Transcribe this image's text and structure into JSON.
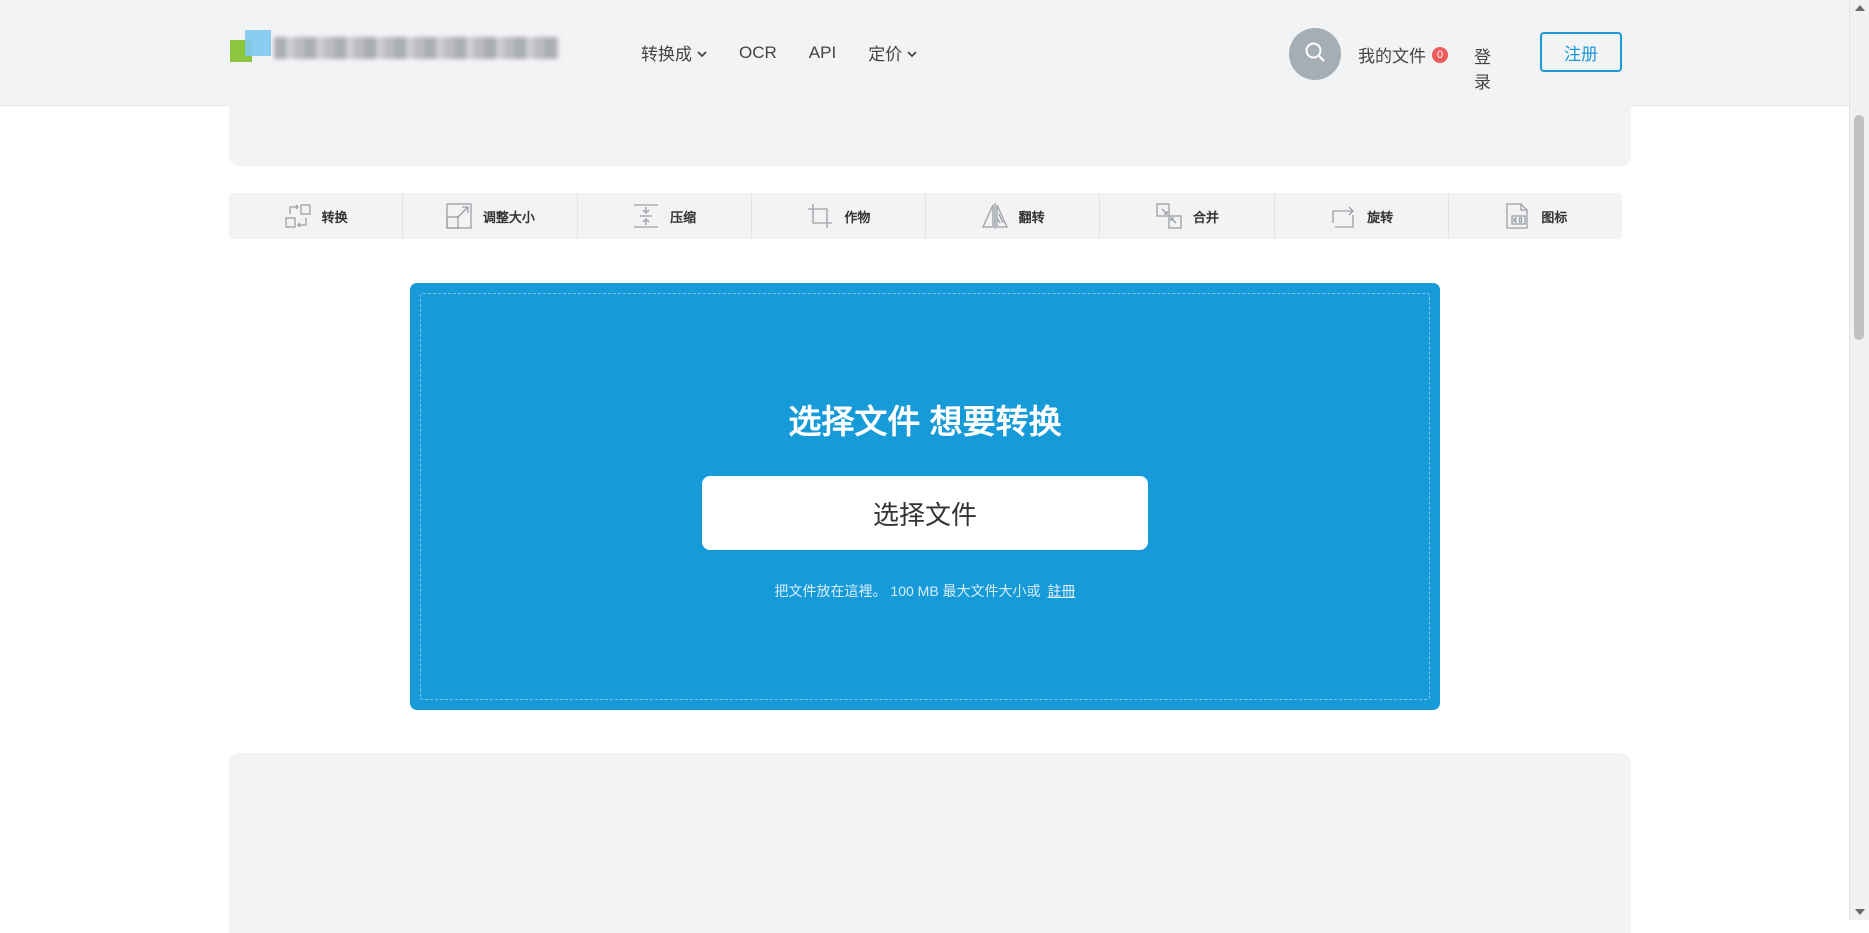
{
  "nav": {
    "items": [
      {
        "label": "转换成",
        "dropdown": true
      },
      {
        "label": "OCR",
        "dropdown": false
      },
      {
        "label": "API",
        "dropdown": false
      },
      {
        "label": "定价",
        "dropdown": true
      }
    ],
    "my_files_label": "我的文件",
    "my_files_count": "0",
    "login_label": "登录",
    "signup_label": "注册"
  },
  "toolbar": {
    "tools": [
      {
        "label": "转换",
        "icon": "convert-icon"
      },
      {
        "label": "调整大小",
        "icon": "resize-icon"
      },
      {
        "label": "压缩",
        "icon": "compress-icon"
      },
      {
        "label": "作物",
        "icon": "crop-icon"
      },
      {
        "label": "翻转",
        "icon": "flip-icon"
      },
      {
        "label": "合并",
        "icon": "merge-icon"
      },
      {
        "label": "旋转",
        "icon": "rotate-icon"
      },
      {
        "label": "图标",
        "icon": "ico-icon"
      }
    ]
  },
  "upload": {
    "title": "选择文件 想要转换",
    "button_label": "选择文件",
    "hint_text": "把文件放在這裡。 100 MB 最大文件大小或",
    "hint_link": "註冊"
  },
  "colors": {
    "accent": "#169ad8",
    "header_bg": "#f2f3f5",
    "badge": "#ee5b5b",
    "signup_border": "#1b9ad6"
  }
}
